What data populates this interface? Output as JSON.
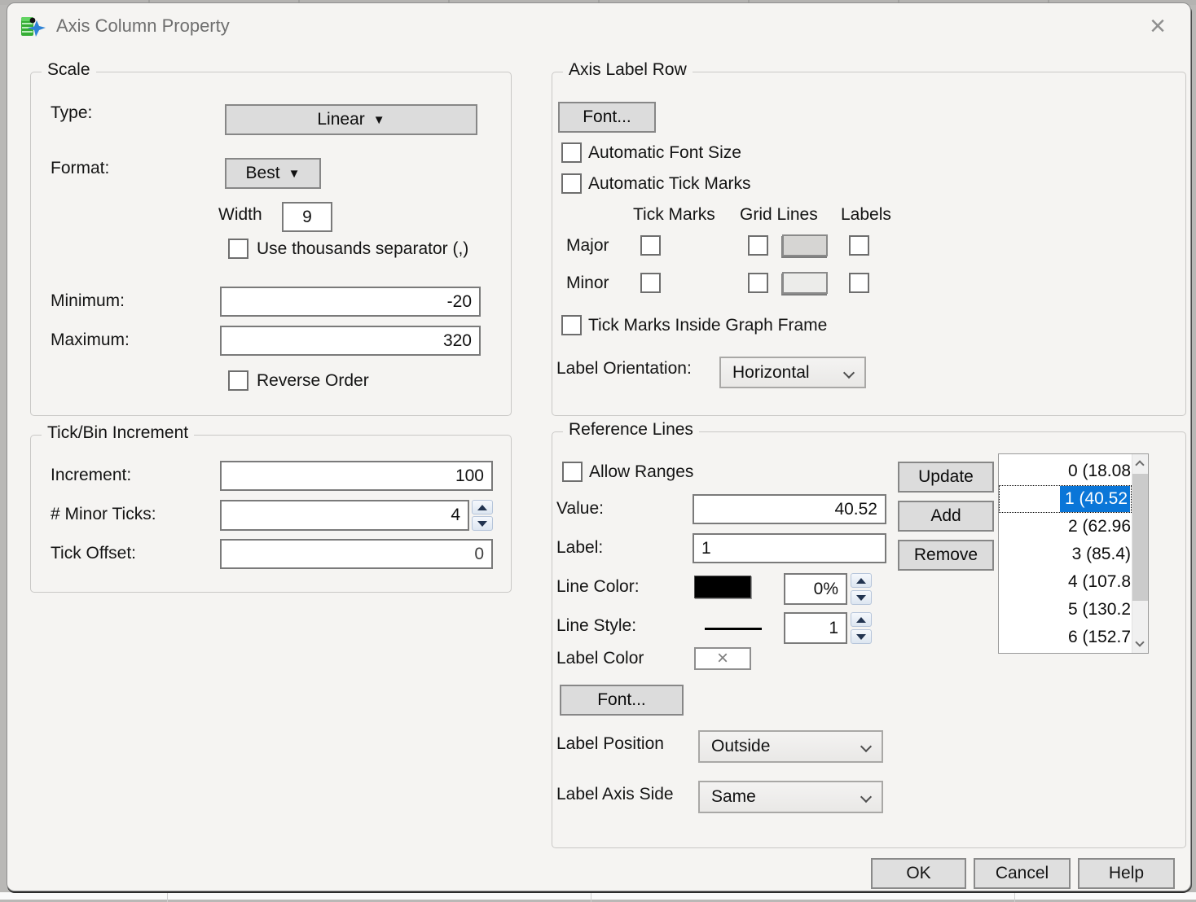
{
  "window": {
    "title": "Axis Column Property",
    "close_glyph": "×"
  },
  "scale": {
    "legend": "Scale",
    "type_label": "Type:",
    "type_value": "Linear",
    "format_label": "Format:",
    "format_value": "Best",
    "width_label": "Width",
    "width_value": "9",
    "thousands_label": "Use thousands separator (,)",
    "thousands_checked": false,
    "minimum_label": "Minimum:",
    "minimum_value": "-20",
    "maximum_label": "Maximum:",
    "maximum_value": "320",
    "reverse_label": "Reverse Order",
    "reverse_checked": false
  },
  "tick_bin": {
    "legend": "Tick/Bin Increment",
    "increment_label": "Increment:",
    "increment_value": "100",
    "minor_ticks_label": "# Minor Ticks:",
    "minor_ticks_value": "4",
    "tick_offset_label": "Tick Offset:",
    "tick_offset_value": "0"
  },
  "axis_label_row": {
    "legend": "Axis Label Row",
    "font_button": "Font...",
    "auto_font_size_label": "Automatic Font Size",
    "auto_font_size_checked": false,
    "auto_tick_marks_label": "Automatic Tick Marks",
    "auto_tick_marks_checked": false,
    "col_tick_marks": "Tick Marks",
    "col_grid_lines": "Grid Lines",
    "col_labels": "Labels",
    "row_major": "Major",
    "row_minor": "Minor",
    "major_grid_swatch_color": "#d6d5d3",
    "minor_grid_swatch_color": "#ececea",
    "inside_frame_label": "Tick Marks Inside Graph Frame",
    "inside_frame_checked": false,
    "orientation_label": "Label Orientation:",
    "orientation_value": "Horizontal"
  },
  "reference_lines": {
    "legend": "Reference Lines",
    "allow_ranges_label": "Allow Ranges",
    "allow_ranges_checked": false,
    "value_label": "Value:",
    "value": "40.52",
    "label_label": "Label:",
    "label_value": "1",
    "line_color_label": "Line Color:",
    "line_color": "#000000",
    "line_alpha": "0%",
    "line_style_label": "Line Style:",
    "line_width": "1",
    "label_color_label": "Label Color",
    "font_button": "Font...",
    "position_label": "Label Position",
    "position_value": "Outside",
    "axis_side_label": "Label Axis Side",
    "axis_side_value": "Same",
    "update_button": "Update",
    "add_button": "Add",
    "remove_button": "Remove",
    "selection_color": "#0a76d8",
    "selected_index": 1,
    "items": [
      {
        "text": "0 (18.08"
      },
      {
        "text": "1 (40.52"
      },
      {
        "text": "2 (62.96"
      },
      {
        "text": "3 (85.4)"
      },
      {
        "text": "4 (107.8"
      },
      {
        "text": "5 (130.2"
      },
      {
        "text": "6 (152.7"
      }
    ]
  },
  "footer": {
    "ok": "OK",
    "cancel": "Cancel",
    "help": "Help"
  }
}
